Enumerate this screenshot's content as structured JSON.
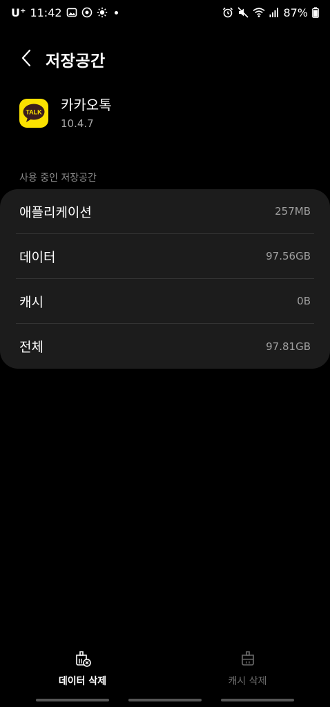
{
  "status_bar": {
    "carrier": "U⁺",
    "time": "11:42",
    "battery": "87%",
    "left_icons": [
      "gallery-icon",
      "app-notification-icon",
      "brightness-icon"
    ],
    "right_icons": [
      "alarm-icon",
      "mute-icon",
      "wifi-icon",
      "signal-icon",
      "battery-icon"
    ]
  },
  "header": {
    "title": "저장공간",
    "back_icon": "chevron-left-icon"
  },
  "app": {
    "name": "카카오톡",
    "version": "10.4.7",
    "icon_text": "TALK",
    "icon_color": "#FAE100"
  },
  "section": {
    "label": "사용 중인 저장공간"
  },
  "storage": {
    "rows": [
      {
        "label": "애플리케이션",
        "value": "257MB"
      },
      {
        "label": "데이터",
        "value": "97.56GB"
      },
      {
        "label": "캐시",
        "value": "0B"
      },
      {
        "label": "전체",
        "value": "97.81GB"
      }
    ]
  },
  "actions": {
    "clear_data": {
      "label": "데이터 삭제",
      "icon": "clear-data-icon",
      "enabled": true
    },
    "clear_cache": {
      "label": "캐시 삭제",
      "icon": "clear-cache-icon",
      "enabled": false
    }
  },
  "colors": {
    "background": "#000000",
    "card": "#1c1c1c",
    "secondary_text": "#a0a0a0",
    "disabled_text": "#6b6b6b",
    "kakao_yellow": "#FAE100"
  }
}
